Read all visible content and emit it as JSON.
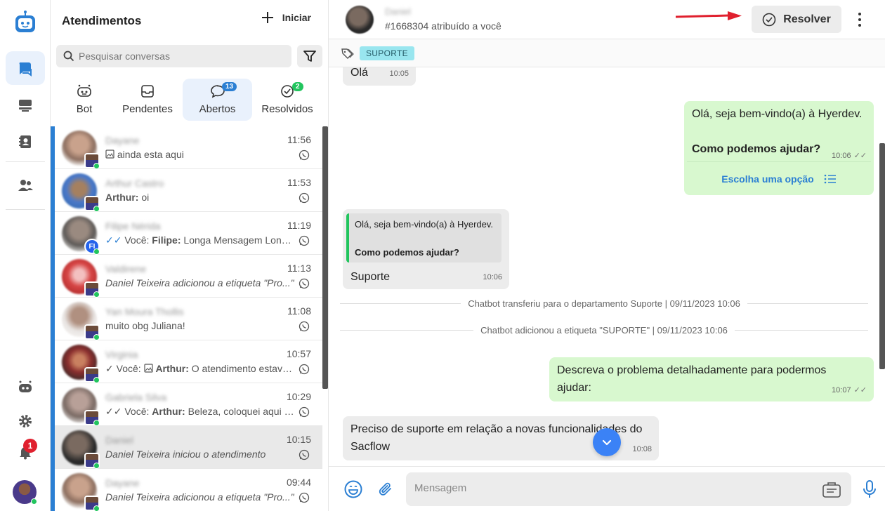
{
  "panel": {
    "title": "Atendimentos",
    "new_label": "Iniciar",
    "search_placeholder": "Pesquisar conversas"
  },
  "tabs": [
    {
      "label": "Bot",
      "badge": ""
    },
    {
      "label": "Pendentes",
      "badge": ""
    },
    {
      "label": "Abertos",
      "badge": "13"
    },
    {
      "label": "Resolvidos",
      "badge": "2"
    }
  ],
  "notifications": {
    "count": "1"
  },
  "conversations": [
    {
      "name": "Dayane",
      "time": "11:56",
      "prefix": "",
      "sender": "",
      "text": "ainda esta aqui"
    },
    {
      "name": "Arthur Castro",
      "time": "11:53",
      "prefix": "",
      "sender": "Arthur:",
      "text": " oi"
    },
    {
      "name": "Filipe Nérida",
      "time": "11:19",
      "prefix": "Você:",
      "sender": "Filipe:",
      "text": " Longa Mensagem Longa Mensagem",
      "avatar_initials": "FI"
    },
    {
      "name": "Valdirene",
      "time": "11:13",
      "prefix": "",
      "sender": "",
      "text": "Daniel Teixeira adicionou a etiqueta \"Pro...\""
    },
    {
      "name": "Yan Moura Thollis",
      "time": "11:08",
      "prefix": "",
      "sender": "",
      "text": "muito obg Juliana!"
    },
    {
      "name": "Virginia",
      "time": "10:57",
      "prefix": "Você:",
      "sender": "Arthur:",
      "text": " O atendimento estava pausado"
    },
    {
      "name": "Gabriela Silva",
      "time": "10:29",
      "prefix": "Você:",
      "sender": "Arthur:",
      "text": " Beleza, coloquei aqui para você"
    },
    {
      "name": "Daniel",
      "time": "10:15",
      "prefix": "",
      "sender": "",
      "text": "Daniel Teixeira iniciou o atendimento"
    },
    {
      "name": "Dayane",
      "time": "09:44",
      "prefix": "",
      "sender": "",
      "text": "Daniel Teixeira adicionou a etiqueta \"Pro...\""
    }
  ],
  "chat": {
    "contact_name": "Daniel",
    "subtitle": "#1668304 atribuído a você",
    "resolve_label": "Resolver",
    "tag": "SUPORTE",
    "messages": {
      "m1_text": "Olá",
      "m1_time": "10:05",
      "m2_line1": "Olá, seja bem-vindo(a) à Hyerdev.",
      "m2_line2": "Como podemos ajudar?",
      "m2_time": "10:06",
      "m2_action": "Escolha uma opção",
      "m3_quote1": "Olá, seja bem-vindo(a) à Hyerdev.",
      "m3_quote2": "Como podemos ajudar?",
      "m3_text": "Suporte",
      "m3_time": "10:06",
      "sys1": "Chatbot transferiu para o departamento Suporte | 09/11/2023 10:06",
      "sys2": "Chatbot adicionou a etiqueta \"SUPORTE\" | 09/11/2023 10:06",
      "m4_text": "Descreva o problema detalhadamente para podermos ajudar:",
      "m4_time": "10:07",
      "m5_text": "Preciso de suporte em relação a novas funcionalidades do Sacflow",
      "m5_time": "10:08"
    },
    "composer_placeholder": "Mensagem"
  }
}
